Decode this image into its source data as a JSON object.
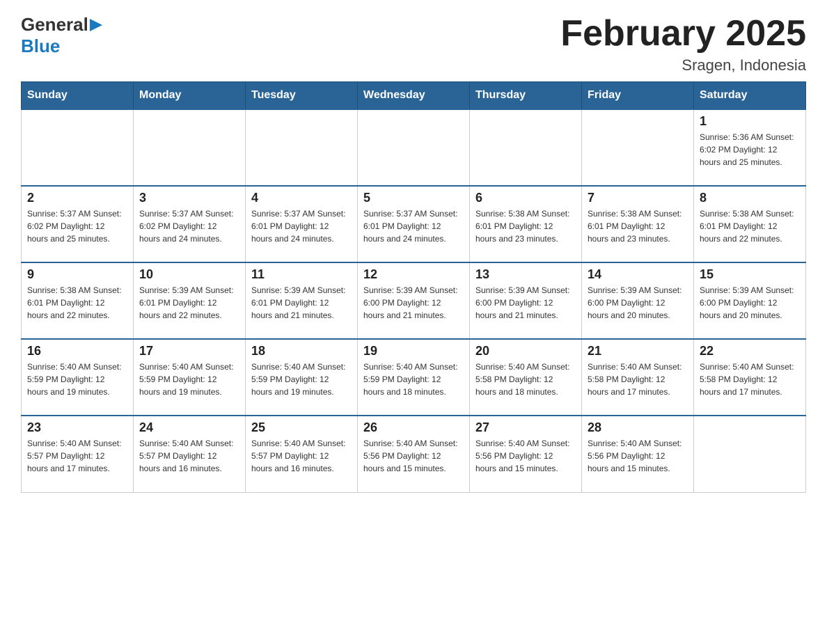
{
  "header": {
    "logo": {
      "general": "General",
      "triangle": "▶",
      "blue": "Blue"
    },
    "title": "February 2025",
    "subtitle": "Sragen, Indonesia"
  },
  "weekdays": [
    "Sunday",
    "Monday",
    "Tuesday",
    "Wednesday",
    "Thursday",
    "Friday",
    "Saturday"
  ],
  "weeks": [
    [
      {
        "day": "",
        "info": ""
      },
      {
        "day": "",
        "info": ""
      },
      {
        "day": "",
        "info": ""
      },
      {
        "day": "",
        "info": ""
      },
      {
        "day": "",
        "info": ""
      },
      {
        "day": "",
        "info": ""
      },
      {
        "day": "1",
        "info": "Sunrise: 5:36 AM\nSunset: 6:02 PM\nDaylight: 12 hours and 25 minutes."
      }
    ],
    [
      {
        "day": "2",
        "info": "Sunrise: 5:37 AM\nSunset: 6:02 PM\nDaylight: 12 hours and 25 minutes."
      },
      {
        "day": "3",
        "info": "Sunrise: 5:37 AM\nSunset: 6:02 PM\nDaylight: 12 hours and 24 minutes."
      },
      {
        "day": "4",
        "info": "Sunrise: 5:37 AM\nSunset: 6:01 PM\nDaylight: 12 hours and 24 minutes."
      },
      {
        "day": "5",
        "info": "Sunrise: 5:37 AM\nSunset: 6:01 PM\nDaylight: 12 hours and 24 minutes."
      },
      {
        "day": "6",
        "info": "Sunrise: 5:38 AM\nSunset: 6:01 PM\nDaylight: 12 hours and 23 minutes."
      },
      {
        "day": "7",
        "info": "Sunrise: 5:38 AM\nSunset: 6:01 PM\nDaylight: 12 hours and 23 minutes."
      },
      {
        "day": "8",
        "info": "Sunrise: 5:38 AM\nSunset: 6:01 PM\nDaylight: 12 hours and 22 minutes."
      }
    ],
    [
      {
        "day": "9",
        "info": "Sunrise: 5:38 AM\nSunset: 6:01 PM\nDaylight: 12 hours and 22 minutes."
      },
      {
        "day": "10",
        "info": "Sunrise: 5:39 AM\nSunset: 6:01 PM\nDaylight: 12 hours and 22 minutes."
      },
      {
        "day": "11",
        "info": "Sunrise: 5:39 AM\nSunset: 6:01 PM\nDaylight: 12 hours and 21 minutes."
      },
      {
        "day": "12",
        "info": "Sunrise: 5:39 AM\nSunset: 6:00 PM\nDaylight: 12 hours and 21 minutes."
      },
      {
        "day": "13",
        "info": "Sunrise: 5:39 AM\nSunset: 6:00 PM\nDaylight: 12 hours and 21 minutes."
      },
      {
        "day": "14",
        "info": "Sunrise: 5:39 AM\nSunset: 6:00 PM\nDaylight: 12 hours and 20 minutes."
      },
      {
        "day": "15",
        "info": "Sunrise: 5:39 AM\nSunset: 6:00 PM\nDaylight: 12 hours and 20 minutes."
      }
    ],
    [
      {
        "day": "16",
        "info": "Sunrise: 5:40 AM\nSunset: 5:59 PM\nDaylight: 12 hours and 19 minutes."
      },
      {
        "day": "17",
        "info": "Sunrise: 5:40 AM\nSunset: 5:59 PM\nDaylight: 12 hours and 19 minutes."
      },
      {
        "day": "18",
        "info": "Sunrise: 5:40 AM\nSunset: 5:59 PM\nDaylight: 12 hours and 19 minutes."
      },
      {
        "day": "19",
        "info": "Sunrise: 5:40 AM\nSunset: 5:59 PM\nDaylight: 12 hours and 18 minutes."
      },
      {
        "day": "20",
        "info": "Sunrise: 5:40 AM\nSunset: 5:58 PM\nDaylight: 12 hours and 18 minutes."
      },
      {
        "day": "21",
        "info": "Sunrise: 5:40 AM\nSunset: 5:58 PM\nDaylight: 12 hours and 17 minutes."
      },
      {
        "day": "22",
        "info": "Sunrise: 5:40 AM\nSunset: 5:58 PM\nDaylight: 12 hours and 17 minutes."
      }
    ],
    [
      {
        "day": "23",
        "info": "Sunrise: 5:40 AM\nSunset: 5:57 PM\nDaylight: 12 hours and 17 minutes."
      },
      {
        "day": "24",
        "info": "Sunrise: 5:40 AM\nSunset: 5:57 PM\nDaylight: 12 hours and 16 minutes."
      },
      {
        "day": "25",
        "info": "Sunrise: 5:40 AM\nSunset: 5:57 PM\nDaylight: 12 hours and 16 minutes."
      },
      {
        "day": "26",
        "info": "Sunrise: 5:40 AM\nSunset: 5:56 PM\nDaylight: 12 hours and 15 minutes."
      },
      {
        "day": "27",
        "info": "Sunrise: 5:40 AM\nSunset: 5:56 PM\nDaylight: 12 hours and 15 minutes."
      },
      {
        "day": "28",
        "info": "Sunrise: 5:40 AM\nSunset: 5:56 PM\nDaylight: 12 hours and 15 minutes."
      },
      {
        "day": "",
        "info": ""
      }
    ]
  ]
}
